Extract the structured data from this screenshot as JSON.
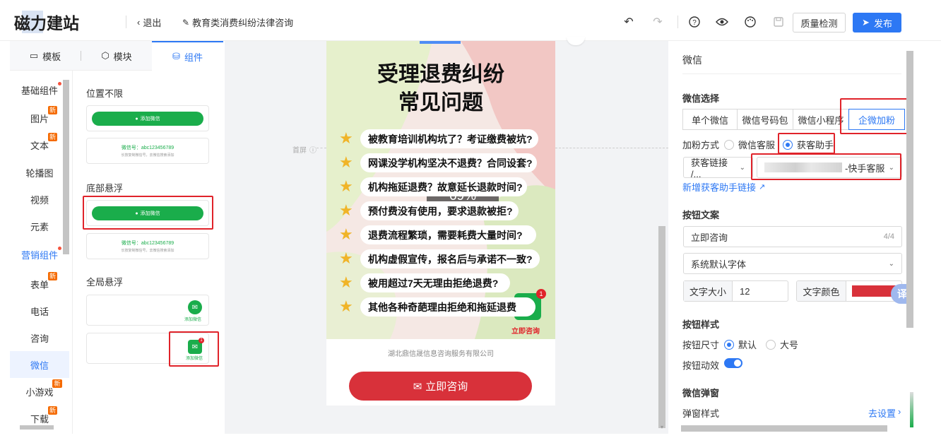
{
  "header": {
    "logo": "磁力建站",
    "exit_label": "退出",
    "page_name": "教育类消费纠纷法律咨询",
    "quality_check": "质量检测",
    "publish": "发布"
  },
  "left_panel": {
    "tabs": [
      {
        "label": "模板",
        "icon": "template-icon"
      },
      {
        "label": "模块",
        "icon": "cube-icon"
      },
      {
        "label": "组件",
        "icon": "database-icon",
        "active": true
      }
    ],
    "categories": [
      {
        "label": "基础组件",
        "dot": true
      },
      {
        "label": "图片",
        "new": "新"
      },
      {
        "label": "文本",
        "new": "新"
      },
      {
        "label": "轮播图"
      },
      {
        "label": "视频"
      },
      {
        "label": "元素"
      },
      {
        "label": "营销组件",
        "dot": true
      },
      {
        "label": "表单",
        "new": "新"
      },
      {
        "label": "电话"
      },
      {
        "label": "咨询"
      },
      {
        "label": "微信",
        "active": true
      },
      {
        "label": "小游戏",
        "new": "新"
      },
      {
        "label": "下载",
        "new": "新"
      }
    ],
    "sections": {
      "position_free": "位置不限",
      "bottom_float": "底部悬浮",
      "global_float": "全局悬浮"
    },
    "add_wechat": "添加微信",
    "wechat_id_line": "微信号：abc123456789",
    "wechat_hint": "长按复制微信号，去微信搜索添加",
    "float_label": "添加微信",
    "float_badge": "1"
  },
  "canvas": {
    "first_screen": "首屏",
    "poster_title_1": "受理退费纠纷",
    "poster_title_2": "常见问题",
    "questions": [
      "被教育培训机构坑了？考证缴费被坑?",
      "网课没学机构坚决不退费？合同设套?",
      "机构拖延退费？故意延长退款时间?",
      "预付费没有使用，要求退款被拒?",
      "退费流程繁琐，需要耗费大量时间?",
      "机构虚假宣传，报名后与承诺不一致?",
      "被用超过7天无理由拒绝退费?",
      "其他各种奇葩理由拒绝和拖延退费"
    ],
    "progress": "69%",
    "float_badge": "1",
    "float_label": "立即咨询",
    "company": "湖北鼎信晟信息咨询服务有限公司",
    "consult_button": "立即咨询"
  },
  "right_panel": {
    "title": "微信",
    "wechat_select": "微信选择",
    "wechat_types": [
      "单个微信",
      "微信号码包",
      "微信小程序",
      "企微加粉"
    ],
    "add_mode_label": "加粉方式",
    "add_modes": [
      "微信客服",
      "获客助手"
    ],
    "link_select": "获客链接 /...",
    "assistant_select": "-快手客服",
    "add_link": "新增获客助手链接",
    "button_copy_title": "按钮文案",
    "button_text": "立即咨询",
    "button_text_count": "4/4",
    "font_select": "系统默认字体",
    "font_size_label": "文字大小",
    "font_size_value": "12",
    "font_color_label": "文字颜色",
    "font_color": "#d8313a",
    "button_style_title": "按钮样式",
    "button_size_label": "按钮尺寸",
    "button_sizes": [
      "默认",
      "大号"
    ],
    "button_anim_label": "按钮动效",
    "popup_title": "微信弹窗",
    "popup_style_label": "弹窗样式",
    "popup_set": "去设置",
    "translate": "译"
  },
  "colors": {
    "primary": "#2d78f4",
    "wechat_green": "#1aad4b",
    "highlight_red": "#e0232a",
    "consult_red": "#d8313a"
  }
}
